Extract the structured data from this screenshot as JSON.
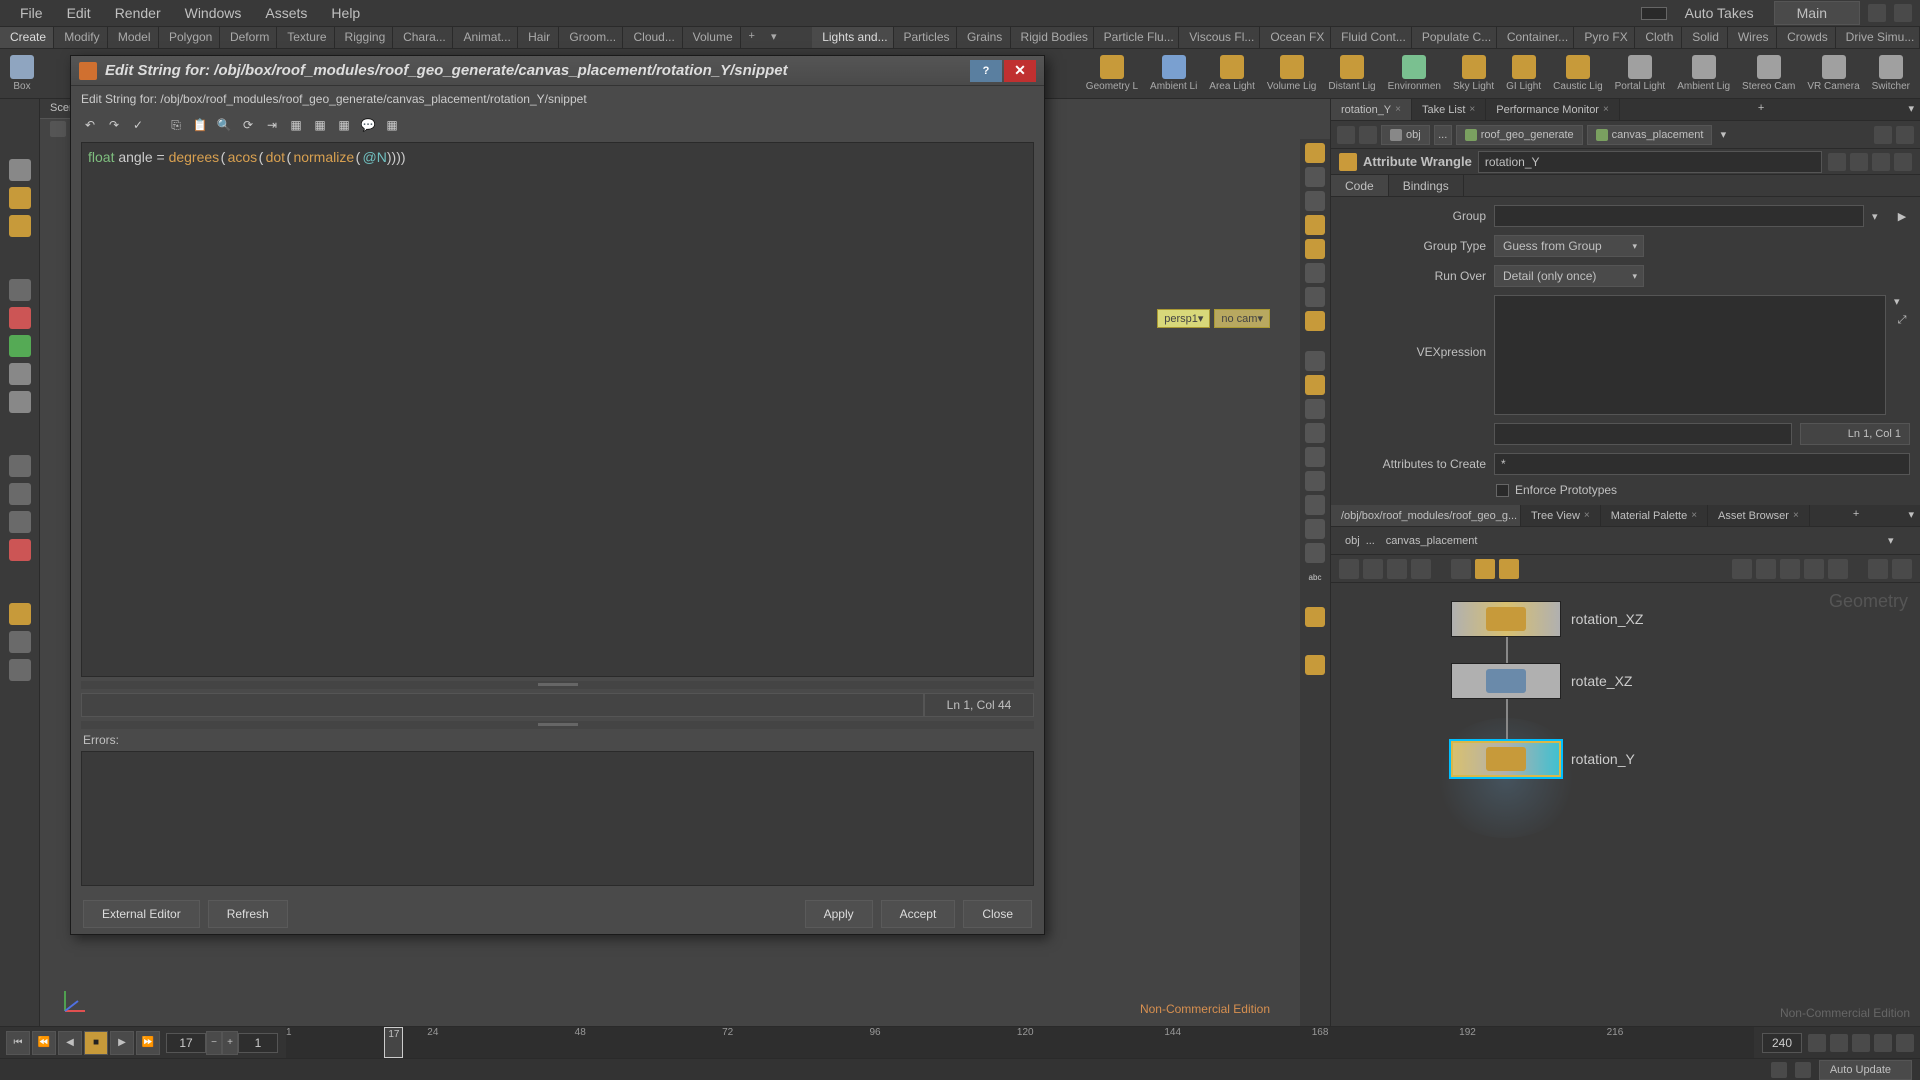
{
  "menubar": {
    "items": [
      "File",
      "Edit",
      "Render",
      "Windows",
      "Assets",
      "Help"
    ],
    "autotakes": "Auto Takes",
    "main": "Main"
  },
  "shelves": [
    "Create",
    "Modify",
    "Model",
    "Polygon",
    "Deform",
    "Texture",
    "Rigging",
    "Chara...",
    "Animat...",
    "Hair",
    "Groom...",
    "Cloud...",
    "Volume"
  ],
  "shelves2": [
    "Lights and...",
    "Particles",
    "Grains",
    "Rigid Bodies",
    "Particle Flu...",
    "Viscous Fl...",
    "Ocean FX",
    "Fluid Cont...",
    "Populate C...",
    "Container...",
    "Pyro FX",
    "Cloth",
    "Solid",
    "Wires",
    "Crowds",
    "Drive Simu..."
  ],
  "tools": [
    {
      "label": "Box",
      "color": "#8fa5c0"
    },
    {
      "label": "Geometry L",
      "color": "#c79a3a"
    },
    {
      "label": "Ambient Li",
      "color": "#7aa0d0"
    },
    {
      "label": "Area Light",
      "color": "#c79a3a"
    },
    {
      "label": "Volume Lig",
      "color": "#c79a3a"
    },
    {
      "label": "Distant Lig",
      "color": "#c79a3a"
    },
    {
      "label": "Environmen",
      "color": "#7ac090"
    },
    {
      "label": "Sky Light",
      "color": "#c79a3a"
    },
    {
      "label": "GI Light",
      "color": "#c79a3a"
    },
    {
      "label": "Caustic Lig",
      "color": "#c79a3a"
    },
    {
      "label": "Portal Light",
      "color": "#a0a0a0"
    },
    {
      "label": "Ambient Lig",
      "color": "#a0a0a0"
    },
    {
      "label": "Stereo Cam",
      "color": "#a0a0a0"
    },
    {
      "label": "VR Camera",
      "color": "#a0a0a0"
    },
    {
      "label": "Switcher",
      "color": "#a0a0a0"
    }
  ],
  "scene_tab": "Scene View",
  "cam": {
    "a": "persp1",
    "b": "no cam"
  },
  "noncommercial": "Non-Commercial Edition",
  "right": {
    "tabs": [
      "rotation_Y",
      "Take List",
      "Performance Monitor"
    ],
    "path": {
      "obj": "obj",
      "a": "roof_geo_generate",
      "b": "canvas_placement"
    },
    "aw": {
      "title": "Attribute Wrangle",
      "name": "rotation_Y",
      "tabs": [
        "Code",
        "Bindings"
      ],
      "group_lbl": "Group",
      "grouptype_lbl": "Group Type",
      "grouptype_val": "Guess from Group",
      "runover_lbl": "Run Over",
      "runover_val": "Detail (only once)",
      "vex_lbl": "VEXpression",
      "cursor": "Ln 1, Col 1",
      "attr_lbl": "Attributes to Create",
      "attr_val": "*",
      "enforce": "Enforce Prototypes"
    },
    "net": {
      "tabs": [
        "/obj/box/roof_modules/roof_geo_g...",
        "Tree View",
        "Material Palette",
        "Asset Browser"
      ],
      "path_obj": "obj",
      "path_last": "canvas_placement",
      "geo": "Geometry",
      "nodes": [
        "rotation_XZ",
        "rotate_XZ",
        "rotation_Y"
      ]
    }
  },
  "timeline": {
    "current": "17",
    "start": "1",
    "end": "240",
    "marker": "17",
    "ticks": [
      "1",
      "24",
      "48",
      "72",
      "96",
      "120",
      "144",
      "168",
      "192",
      "216"
    ]
  },
  "status": {
    "autoupdate": "Auto Update"
  },
  "modal": {
    "title": "Edit String for: /obj/box/roof_modules/roof_geo_generate/canvas_placement/rotation_Y/snippet",
    "sub": "Edit String for: /obj/box/roof_modules/roof_geo_generate/canvas_placement/rotation_Y/snippet",
    "code_kw": "float",
    "code_var": " angle = ",
    "code_fn1": "degrees",
    "code_fn2": "acos",
    "code_fn3": "dot",
    "code_fn4": "normalize",
    "code_at": "@N",
    "code_tail": "))))",
    "curs": "Ln 1, Col 44",
    "errors": "Errors:",
    "btn_ext": "External Editor",
    "btn_refresh": "Refresh",
    "btn_apply": "Apply",
    "btn_accept": "Accept",
    "btn_close": "Close"
  }
}
